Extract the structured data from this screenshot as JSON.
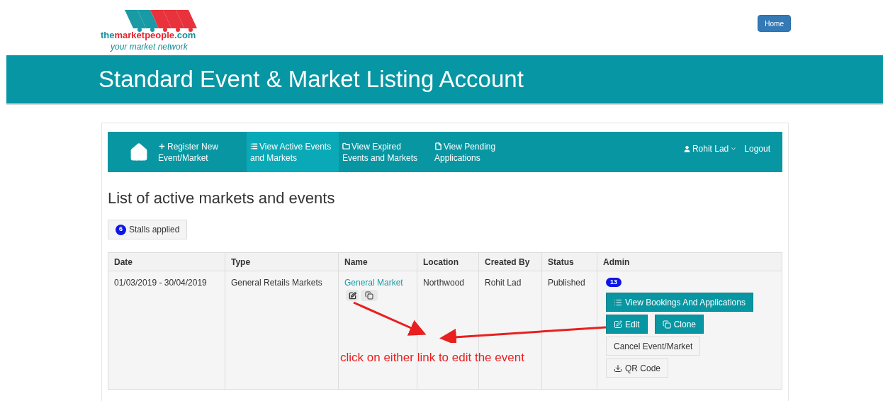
{
  "logo": {
    "prefix": "the",
    "main": "marketpeople",
    "suffix": ".com",
    "tagline": "your market network"
  },
  "home_button": "Home",
  "banner": {
    "title": "Standard Event & Market Listing Account"
  },
  "nav": {
    "items": [
      {
        "label": "Register New Event/Market",
        "selected": false
      },
      {
        "label": "View Active Events and Markets",
        "selected": true
      },
      {
        "label": "View Expired Events and Markets",
        "selected": false
      },
      {
        "label": "View Pending Applications",
        "selected": false
      }
    ],
    "user": "Rohit Lad",
    "logout": "Logout"
  },
  "heading": "List of active markets and events",
  "stalls": {
    "count": "6",
    "label": "Stalls applied"
  },
  "table": {
    "columns": [
      "Date",
      "Type",
      "Name",
      "Location",
      "Created By",
      "Status",
      "Admin"
    ],
    "rows": [
      {
        "date": "01/03/2019 - 30/04/2019",
        "type": "General Retails Markets",
        "name": "General Market",
        "location": "Northwood",
        "created_by": "Rohit Lad",
        "status": "Published",
        "count": "13",
        "actions": [
          {
            "label": "View Bookings And Applications",
            "kind": "primary"
          },
          {
            "label": "Edit",
            "kind": "primary"
          },
          {
            "label": "Clone",
            "kind": "primary"
          },
          {
            "label": "Cancel Event/Market",
            "kind": "plain"
          },
          {
            "label": "QR Code",
            "kind": "plain"
          }
        ]
      }
    ]
  },
  "annotation": "click on either link to edit the event"
}
